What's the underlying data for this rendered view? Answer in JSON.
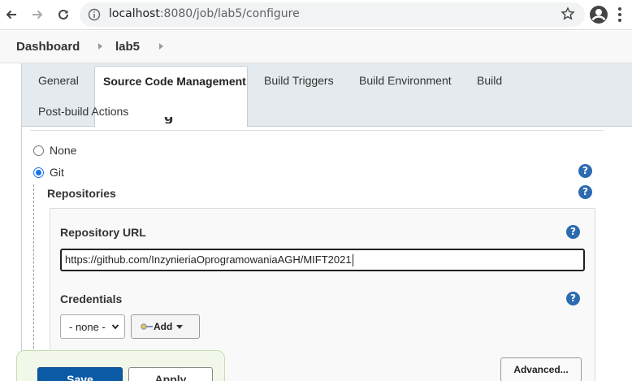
{
  "browser": {
    "url_host": "localhost",
    "url_path": ":8080/job/lab5/configure",
    "icons": {
      "back": "arrow-left-icon",
      "forward": "arrow-right-icon",
      "reload": "reload-icon",
      "info": "info-icon",
      "bookmark": "star-icon",
      "profile": "account-icon",
      "menu": "kebab-menu-icon"
    }
  },
  "breadcrumb": {
    "items": [
      "Dashboard",
      "lab5"
    ]
  },
  "tabs": [
    {
      "label": "General",
      "active": false
    },
    {
      "label": "Source Code Management",
      "active": true
    },
    {
      "label": "Build Triggers",
      "active": false
    },
    {
      "label": "Build Environment",
      "active": false
    },
    {
      "label": "Build",
      "active": false
    },
    {
      "label": "Post-build Actions",
      "active": false
    }
  ],
  "scm": {
    "section_heading_fragment": "g",
    "options": [
      {
        "label": "None",
        "selected": false
      },
      {
        "label": "Git",
        "selected": true
      }
    ],
    "help_glyph": "?",
    "repositories_label": "Repositories",
    "repository_url_label": "Repository URL",
    "repository_url_value": "https://github.com/InzynieriaOprogramowaniaAGH/MIFT2021",
    "credentials_label": "Credentials",
    "credentials_selected": "- none -",
    "add_label": "Add",
    "advanced_label": "Advanced..."
  },
  "actions": {
    "save_label": "Save",
    "apply_label": "Apply"
  },
  "colors": {
    "accent": "#0b5aa5",
    "help_icon": "#2c6bb0",
    "tabbar_bg": "#e5eaee",
    "bottom_bar_bg": "#f1f8ea"
  }
}
